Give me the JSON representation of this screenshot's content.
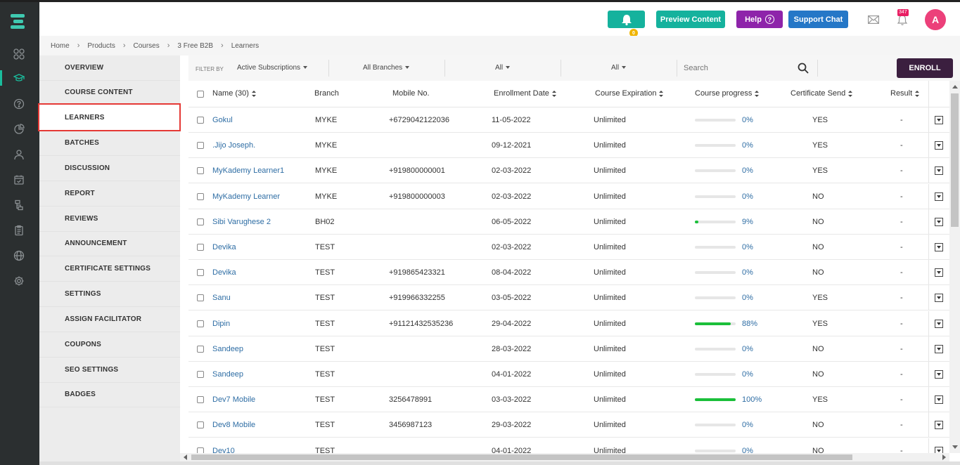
{
  "topbar": {
    "bell_badge": "0",
    "preview_label": "Preview Content",
    "help_label": "Help",
    "help_q": "?",
    "support_label": "Support Chat",
    "notif_count": "347",
    "avatar_letter": "A"
  },
  "breadcrumb": [
    "Home",
    "Products",
    "Courses",
    "3 Free B2B",
    "Learners"
  ],
  "sidebar": {
    "items": [
      "OVERVIEW",
      "COURSE CONTENT",
      "LEARNERS",
      "BATCHES",
      "DISCUSSION",
      "REPORT",
      "REVIEWS",
      "ANNOUNCEMENT",
      "CERTIFICATE SETTINGS",
      "SETTINGS",
      "ASSIGN FACILITATOR",
      "COUPONS",
      "SEO SETTINGS",
      "BADGES"
    ],
    "active": "LEARNERS"
  },
  "filters": {
    "label": "FILTER BY",
    "subscription": "Active Subscriptions",
    "branches": "All Branches",
    "filter3": "All",
    "filter4": "All",
    "search_placeholder": "Search",
    "enroll_label": "ENROLL"
  },
  "table": {
    "headers": {
      "name": "Name (30)",
      "branch": "Branch",
      "mobile": "Mobile No.",
      "enrollment": "Enrollment Date",
      "expiration": "Course Expiration",
      "progress": "Course progress",
      "certificate": "Certificate Send",
      "result": "Result"
    },
    "rows": [
      {
        "name": "Gokul",
        "branch": "MYKE",
        "mobile": "+6729042122036",
        "date": "11-05-2022",
        "expiration": "Unlimited",
        "progress": 0,
        "progress_label": "0%",
        "certificate": "YES",
        "result": "-"
      },
      {
        "name": ".Jijo Joseph.",
        "branch": "MYKE",
        "mobile": "",
        "date": "09-12-2021",
        "expiration": "Unlimited",
        "progress": 0,
        "progress_label": "0%",
        "certificate": "YES",
        "result": "-"
      },
      {
        "name": "MyKademy Learner1",
        "branch": "MYKE",
        "mobile": "+919800000001",
        "date": "02-03-2022",
        "expiration": "Unlimited",
        "progress": 0,
        "progress_label": "0%",
        "certificate": "YES",
        "result": "-"
      },
      {
        "name": "MyKademy Learner",
        "branch": "MYKE",
        "mobile": "+919800000003",
        "date": "02-03-2022",
        "expiration": "Unlimited",
        "progress": 0,
        "progress_label": "0%",
        "certificate": "NO",
        "result": "-"
      },
      {
        "name": "Sibi Varughese 2",
        "branch": "BH02",
        "mobile": "",
        "date": "06-05-2022",
        "expiration": "Unlimited",
        "progress": 9,
        "progress_label": "9%",
        "certificate": "NO",
        "result": "-"
      },
      {
        "name": "Devika",
        "branch": "TEST",
        "mobile": "",
        "date": "02-03-2022",
        "expiration": "Unlimited",
        "progress": 0,
        "progress_label": "0%",
        "certificate": "NO",
        "result": "-"
      },
      {
        "name": "Devika",
        "branch": "TEST",
        "mobile": "+919865423321",
        "date": "08-04-2022",
        "expiration": "Unlimited",
        "progress": 0,
        "progress_label": "0%",
        "certificate": "NO",
        "result": "-"
      },
      {
        "name": "Sanu",
        "branch": "TEST",
        "mobile": "+919966332255",
        "date": "03-05-2022",
        "expiration": "Unlimited",
        "progress": 0,
        "progress_label": "0%",
        "certificate": "YES",
        "result": "-"
      },
      {
        "name": "Dipin",
        "branch": "TEST",
        "mobile": "+91121432535236",
        "date": "29-04-2022",
        "expiration": "Unlimited",
        "progress": 88,
        "progress_label": "88%",
        "certificate": "YES",
        "result": "-"
      },
      {
        "name": "Sandeep",
        "branch": "TEST",
        "mobile": "",
        "date": "28-03-2022",
        "expiration": "Unlimited",
        "progress": 0,
        "progress_label": "0%",
        "certificate": "NO",
        "result": "-"
      },
      {
        "name": "Sandeep",
        "branch": "TEST",
        "mobile": "",
        "date": "04-01-2022",
        "expiration": "Unlimited",
        "progress": 0,
        "progress_label": "0%",
        "certificate": "NO",
        "result": "-"
      },
      {
        "name": "Dev7 Mobile",
        "branch": "TEST",
        "mobile": "3256478991",
        "date": "03-03-2022",
        "expiration": "Unlimited",
        "progress": 100,
        "progress_label": "100%",
        "certificate": "YES",
        "result": "-"
      },
      {
        "name": "Dev8 Mobile",
        "branch": "TEST",
        "mobile": "3456987123",
        "date": "29-03-2022",
        "expiration": "Unlimited",
        "progress": 0,
        "progress_label": "0%",
        "certificate": "NO",
        "result": "-"
      },
      {
        "name": "Dev10",
        "branch": "TEST",
        "mobile": "",
        "date": "04-01-2022",
        "expiration": "Unlimited",
        "progress": 0,
        "progress_label": "0%",
        "certificate": "NO",
        "result": "-"
      }
    ]
  },
  "icons": {
    "rail": [
      "dashboard-icon",
      "graduation-cap-icon",
      "help-circle-icon",
      "pie-chart-icon",
      "user-icon",
      "calendar-icon",
      "sitemap-icon",
      "clipboard-icon",
      "globe-icon",
      "gear-icon"
    ]
  },
  "colors": {
    "accent": "#15b29d",
    "help": "#8e24aa",
    "support": "#2577c7",
    "enroll": "#3b1f3f",
    "progress": "#1bbf3a",
    "active_border": "#e53935"
  }
}
